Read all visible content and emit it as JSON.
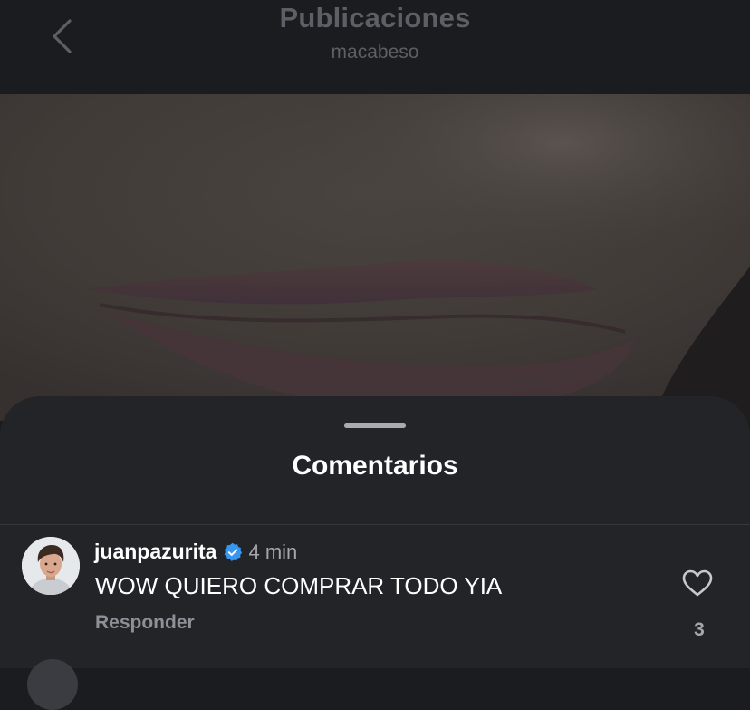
{
  "header": {
    "back_icon": "chevron-left-icon",
    "title": "Publicaciones",
    "subtitle": "macabeso"
  },
  "photo": {
    "description_icon": "post-photo"
  },
  "sheet": {
    "title": "Comentarios"
  },
  "comments": [
    {
      "username": "juanpazurita",
      "verified": true,
      "time": "4 min",
      "text": "WOW QUIERO COMPRAR TODO YIA",
      "reply_label": "Responder",
      "like_icon": "heart-icon",
      "like_count": "3"
    }
  ],
  "colors": {
    "background": "#1b1c1f",
    "sheet": "#232428",
    "verified_badge": "#3797f0",
    "muted_text": "#a4a7ad"
  }
}
